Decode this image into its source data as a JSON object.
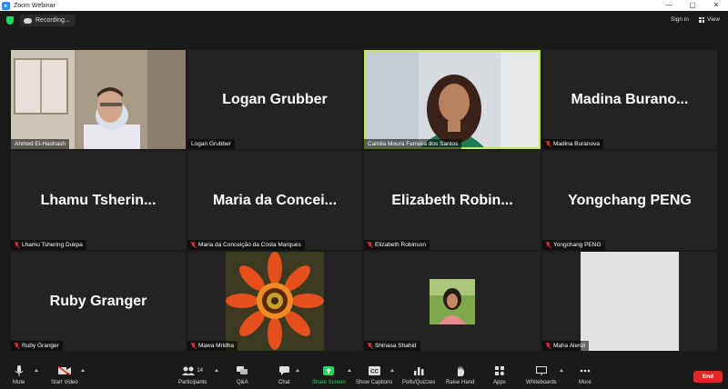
{
  "window": {
    "title": "Zoom Webinar",
    "controls": [
      "—",
      "▢",
      "✕"
    ]
  },
  "topbar": {
    "recording_label": "Recording...",
    "signin_label": "Sign in",
    "view_label": "View"
  },
  "participants": [
    {
      "big_name": "",
      "label": "Ahmed El-Hashash",
      "muted": false
    },
    {
      "big_name": "Logan Grubber",
      "label": "Logan Grubber",
      "muted": false
    },
    {
      "big_name": "",
      "label": "Camila Moura Ferreira dos Santos",
      "muted": false
    },
    {
      "big_name": "Madina Burano...",
      "label": "Madina Buranova",
      "muted": true
    },
    {
      "big_name": "Lhamu Tsherin...",
      "label": "Lhamu Tshering Dukpa",
      "muted": true
    },
    {
      "big_name": "Maria da Concei...",
      "label": "Maria da Conceição da Costa Marques",
      "muted": true
    },
    {
      "big_name": "Elizabeth Robin...",
      "label": "Elizabeth Robinson",
      "muted": true
    },
    {
      "big_name": "Yongchang PENG",
      "label": "Yongchang PENG",
      "muted": true
    },
    {
      "big_name": "Ruby Granger",
      "label": "Ruby Granger",
      "muted": true
    },
    {
      "big_name": "",
      "label": "Mawa Mridha",
      "muted": true
    },
    {
      "big_name": "",
      "label": "Shinasa Shahid",
      "muted": true
    },
    {
      "big_name": "",
      "label": "Maha Alenzi",
      "muted": true
    }
  ],
  "toolbar": {
    "mute": "Mute",
    "start_video": "Start Video",
    "participants": "Participants",
    "participants_count": "14",
    "qa": "Q&A",
    "chat": "Chat",
    "share_screen": "Share Screen",
    "show_captions": "Show Captions",
    "polls": "Polls/Quizzes",
    "raise_hand": "Raise Hand",
    "apps": "Apps",
    "whiteboards": "Whiteboards",
    "more": "More",
    "end": "End"
  },
  "colors": {
    "accent": "#2d8cff",
    "share": "#23d959",
    "end": "#e02828",
    "active_speaker": "#c5e85a"
  }
}
